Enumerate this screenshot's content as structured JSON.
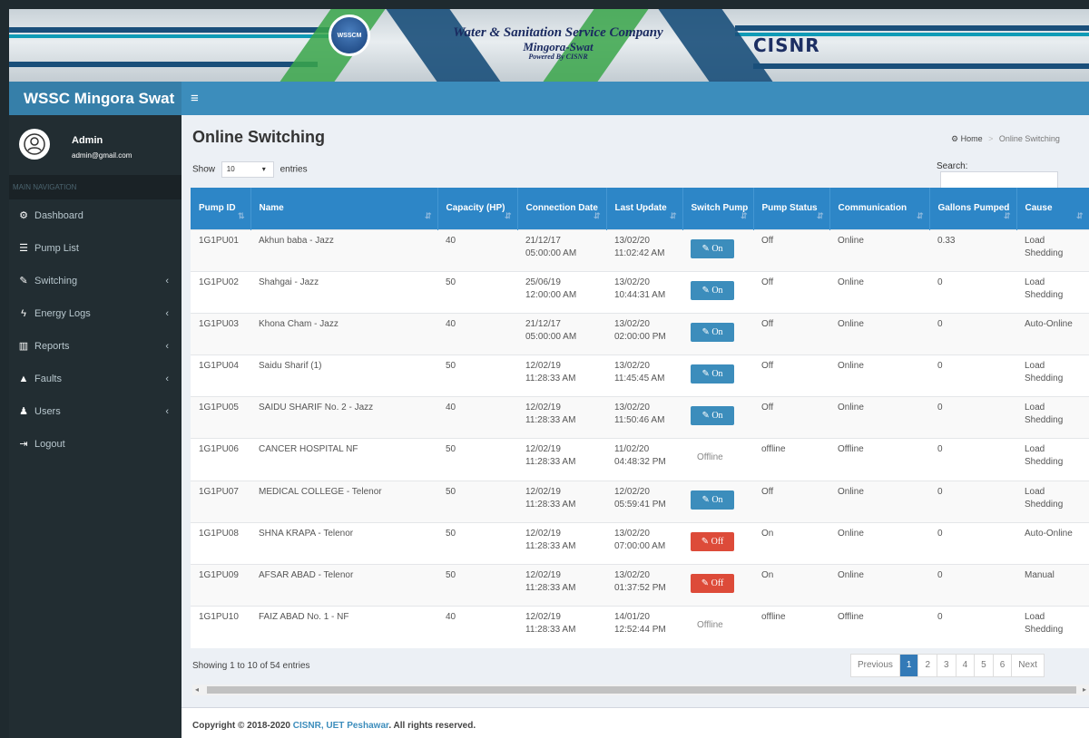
{
  "banner": {
    "logo_text": "WSSCM",
    "title_line1": "Water & Sanitation Service Company",
    "title_line2": "Mingora-Swat",
    "title_line3": "Powered By CISNR",
    "partner_logo": "CISNR"
  },
  "header": {
    "brand": "WSSC Mingora Swat",
    "menu_icon": "hamburger-icon"
  },
  "user": {
    "name": "Admin",
    "email": "admin@gmail.com"
  },
  "sidebar": {
    "header": "MAIN NAVIGATION",
    "items": [
      {
        "label": "Dashboard",
        "icon": "dashboard-icon",
        "glyph": "⚙"
      },
      {
        "label": "Pump List",
        "icon": "list-icon",
        "glyph": "☰"
      },
      {
        "label": "Switching",
        "icon": "plug-icon",
        "glyph": "✎"
      },
      {
        "label": "Energy Logs",
        "icon": "bolt-icon",
        "glyph": "ϟ"
      },
      {
        "label": "Reports",
        "icon": "bar-chart-icon",
        "glyph": "▥"
      },
      {
        "label": "Faults",
        "icon": "warning-icon",
        "glyph": "▲"
      },
      {
        "label": "Users",
        "icon": "user-icon",
        "glyph": "♟"
      },
      {
        "label": "Logout",
        "icon": "sign-out-icon",
        "glyph": "⇥"
      }
    ]
  },
  "page": {
    "title": "Online Switching",
    "breadcrumb_home": "Home",
    "breadcrumb_current": "Online Switching",
    "show_label": "Show",
    "show_value": "10",
    "entries_label": "entries",
    "search_label": "Search:",
    "search_value": ""
  },
  "table": {
    "headers": [
      "Pump ID",
      "Name",
      "Capacity (HP)",
      "Connection Date",
      "Last Update",
      "Switch Pump",
      "Pump Status",
      "Communication",
      "Gallons Pumped",
      "Cause"
    ],
    "rows": [
      {
        "id": "1G1PU01",
        "name": "Akhun baba - Jazz",
        "capacity": "40",
        "conn_date": "21/12/17",
        "conn_time": "05:00:00 AM",
        "upd_date": "13/02/20",
        "upd_time": "11:02:42 AM",
        "switch": "On",
        "status": "Off",
        "comm": "Online",
        "gallons": "0.33",
        "cause": "Load Shedding"
      },
      {
        "id": "1G1PU02",
        "name": "Shahgai - Jazz",
        "capacity": "50",
        "conn_date": "25/06/19",
        "conn_time": "12:00:00 AM",
        "upd_date": "13/02/20",
        "upd_time": "10:44:31 AM",
        "switch": "On",
        "status": "Off",
        "comm": "Online",
        "gallons": "0",
        "cause": "Load Shedding"
      },
      {
        "id": "1G1PU03",
        "name": "Khona Cham - Jazz",
        "capacity": "40",
        "conn_date": "21/12/17",
        "conn_time": "05:00:00 AM",
        "upd_date": "13/02/20",
        "upd_time": "02:00:00 PM",
        "switch": "On",
        "status": "Off",
        "comm": "Online",
        "gallons": "0",
        "cause": "Auto-Online"
      },
      {
        "id": "1G1PU04",
        "name": "Saidu Sharif (1)",
        "capacity": "50",
        "conn_date": "12/02/19",
        "conn_time": "11:28:33 AM",
        "upd_date": "13/02/20",
        "upd_time": "11:45:45 AM",
        "switch": "On",
        "status": "Off",
        "comm": "Online",
        "gallons": "0",
        "cause": "Load Shedding"
      },
      {
        "id": "1G1PU05",
        "name": "SAIDU SHARIF No. 2 - Jazz",
        "capacity": "40",
        "conn_date": "12/02/19",
        "conn_time": "11:28:33 AM",
        "upd_date": "13/02/20",
        "upd_time": "11:50:46 AM",
        "switch": "On",
        "status": "Off",
        "comm": "Online",
        "gallons": "0",
        "cause": "Load Shedding"
      },
      {
        "id": "1G1PU06",
        "name": "CANCER HOSPITAL NF",
        "capacity": "50",
        "conn_date": "12/02/19",
        "conn_time": "11:28:33 AM",
        "upd_date": "11/02/20",
        "upd_time": "04:48:32 PM",
        "switch": "Offline",
        "status": "offline",
        "comm": "Offline",
        "gallons": "0",
        "cause": "Load Shedding"
      },
      {
        "id": "1G1PU07",
        "name": "MEDICAL COLLEGE - Telenor",
        "capacity": "50",
        "conn_date": "12/02/19",
        "conn_time": "11:28:33 AM",
        "upd_date": "12/02/20",
        "upd_time": "05:59:41 PM",
        "switch": "On",
        "status": "Off",
        "comm": "Online",
        "gallons": "0",
        "cause": "Load Shedding"
      },
      {
        "id": "1G1PU08",
        "name": "SHNA KRAPA - Telenor",
        "capacity": "50",
        "conn_date": "12/02/19",
        "conn_time": "11:28:33 AM",
        "upd_date": "13/02/20",
        "upd_time": "07:00:00 AM",
        "switch": "Off",
        "status": "On",
        "comm": "Online",
        "gallons": "0",
        "cause": "Auto-Online"
      },
      {
        "id": "1G1PU09",
        "name": "AFSAR ABAD - Telenor",
        "capacity": "50",
        "conn_date": "12/02/19",
        "conn_time": "11:28:33 AM",
        "upd_date": "13/02/20",
        "upd_time": "01:37:52 PM",
        "switch": "Off",
        "status": "On",
        "comm": "Online",
        "gallons": "0",
        "cause": "Manual"
      },
      {
        "id": "1G1PU10",
        "name": "FAIZ ABAD No. 1 - NF",
        "capacity": "40",
        "conn_date": "12/02/19",
        "conn_time": "11:28:33 AM",
        "upd_date": "14/01/20",
        "upd_time": "12:52:44 PM",
        "switch": "Offline",
        "status": "offline",
        "comm": "Offline",
        "gallons": "0",
        "cause": "Load Shedding"
      }
    ]
  },
  "pagination": {
    "info": "Showing 1 to 10 of 54 entries",
    "previous": "Previous",
    "pages": [
      "1",
      "2",
      "3",
      "4",
      "5",
      "6"
    ],
    "active": "1",
    "next": "Next"
  },
  "footer": {
    "prefix": "Copyright © 2018-2020 ",
    "link": "CISNR, UET Peshawar",
    "suffix": ". All rights reserved."
  },
  "colors": {
    "header": "#3c8dbc",
    "sidebar": "#222d32",
    "table_header": "#2d86c7",
    "btn_on": "#3c8dbc",
    "btn_off": "#dd4b39"
  }
}
